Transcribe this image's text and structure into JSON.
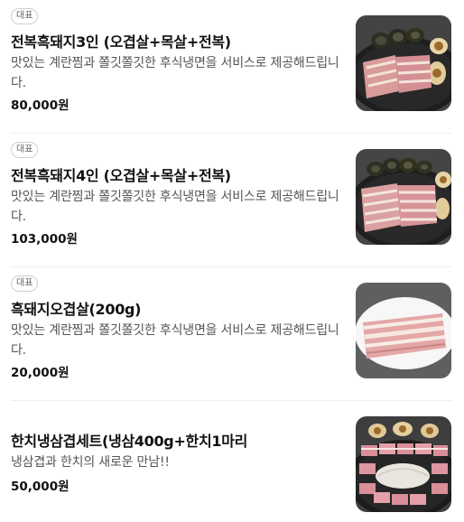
{
  "menu": {
    "items": [
      {
        "badge": "대표",
        "title": "전복흑돼지3인 (오겹살+목살+전복)",
        "desc": "맛있는 계란찜과 쫄깃쫄깃한 후식냉면을 서비스로 제공해드립니다.",
        "price": "80,000원",
        "image": "pork-abalone-platter-photo"
      },
      {
        "badge": "대표",
        "title": "전복흑돼지4인 (오겹살+목살+전복)",
        "desc": "맛있는 계란찜과 쫄깃쫄깃한 후식냉면을 서비스로 제공해드립니다.",
        "price": "103,000원",
        "image": "pork-abalone-platter-photo"
      },
      {
        "badge": "대표",
        "title": "흑돼지오겹살(200g)",
        "desc": "맛있는 계란찜과 쫄깃쫄깃한 후식냉면을 서비스로 제공해드립니다.",
        "price": "20,000원",
        "image": "pork-belly-photo"
      },
      {
        "title": "한치냉삼겹세트(냉삼400g+한치1마리",
        "desc": "냉삼겹과 한치의 새로운 만남!!",
        "price": "50,000원",
        "image": "frozen-pork-squid-platter-photo"
      }
    ]
  }
}
